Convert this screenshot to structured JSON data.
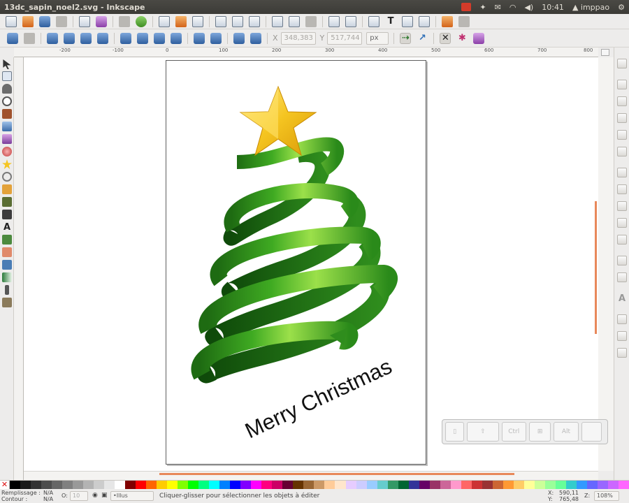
{
  "window": {
    "title": "13dc_sapin_noel2.svg - Inkscape"
  },
  "top_panel": {
    "clock": "10:41",
    "user": "imppao"
  },
  "control_bar": {
    "x_label": "X",
    "x_value": "348,383",
    "y_label": "Y",
    "y_value": "517,744",
    "unit": "px"
  },
  "ruler": {
    "ticks": [
      "-200",
      "-100",
      "0",
      "100",
      "200",
      "300",
      "400",
      "500",
      "600",
      "700",
      "800"
    ]
  },
  "canvas": {
    "greeting": "Merry Christmas",
    "colors": {
      "ribbon_dark": "#1e6b12",
      "ribbon_light": "#9be04a",
      "star": "#f5c521"
    }
  },
  "onscreen_keyboard": {
    "keys": [
      "⇧",
      "Ctrl",
      "⊞",
      "Alt",
      ""
    ]
  },
  "palette": {
    "colors": [
      "#000000",
      "#1a1a1a",
      "#333333",
      "#4d4d4d",
      "#666666",
      "#808080",
      "#999999",
      "#b3b3b3",
      "#cccccc",
      "#e6e6e6",
      "#ffffff",
      "#800000",
      "#ff0000",
      "#ff6600",
      "#ffcc00",
      "#ffff00",
      "#80ff00",
      "#00ff00",
      "#00ff80",
      "#00ffff",
      "#0080ff",
      "#0000ff",
      "#8000ff",
      "#ff00ff",
      "#ff0080",
      "#cc0066",
      "#660033",
      "#663300",
      "#996633",
      "#cc9966",
      "#ffcc99",
      "#ffe6cc",
      "#e6ccff",
      "#ccccff",
      "#99ccff",
      "#66cccc",
      "#339966",
      "#006633",
      "#333399",
      "#660066",
      "#993366",
      "#cc6699",
      "#ff99cc",
      "#ff6666",
      "#cc3333",
      "#993333",
      "#cc6633",
      "#ff9933",
      "#ffcc66",
      "#ffff99",
      "#ccff99",
      "#99ff99",
      "#66ff99",
      "#33cccc",
      "#3399ff",
      "#6666ff",
      "#9966ff",
      "#cc66ff",
      "#ff66ff"
    ]
  },
  "status": {
    "fill_label": "Remplissage :",
    "fill_value": "N/A",
    "stroke_label": "Contour :",
    "stroke_value": "N/A",
    "opacity_label": "O:",
    "opacity_value": "10",
    "layer": "•Illus",
    "message": "Cliquer-glisser pour sélectionner les objets à éditer",
    "x_label": "X:",
    "x_value": "590,11",
    "y_label": "Y:",
    "y_value": "765,48",
    "zoom_label": "Z:",
    "zoom_value": "108%"
  }
}
